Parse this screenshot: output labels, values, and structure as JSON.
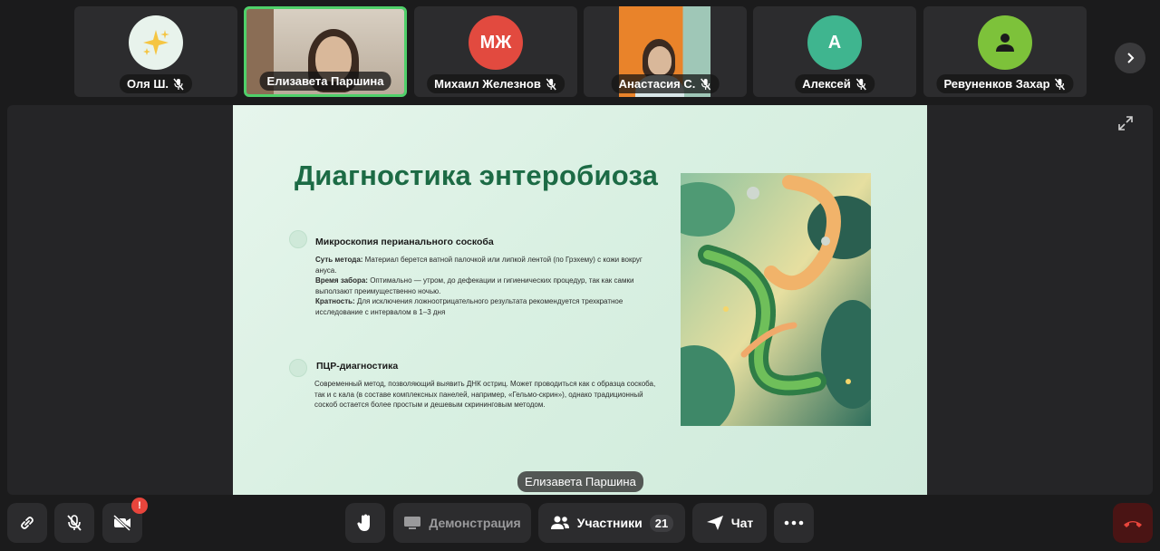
{
  "participants": [
    {
      "name": "Оля Ш.",
      "avatar_icon": "sparkles-icon",
      "avatar_bg": "#e8f3ec",
      "muted": true
    },
    {
      "name": "Елизавета Паршина",
      "video": true,
      "active": true,
      "muted": false
    },
    {
      "name": "Михаил Железнов",
      "initials": "МЖ",
      "avatar_bg": "#e24a3f",
      "muted": true
    },
    {
      "name": "Анастасия С.",
      "video": true,
      "muted": true
    },
    {
      "name": "Алексей",
      "initials": "А",
      "avatar_bg": "#3fb58f",
      "muted": true
    },
    {
      "name": "Ревуненков Захар",
      "avatar_icon": "person-icon",
      "avatar_bg": "#7dc23a",
      "muted": true
    }
  ],
  "slide": {
    "title": "Диагностика энтеробиоза",
    "section1": {
      "title": "Микроскопия перианального соскоба",
      "method_label": "Суть метода:",
      "method_text": " Материал берется ватной палочкой или липкой лентой (по Грэхему) с кожи вокруг ануса.",
      "time_label": "Время забора:",
      "time_text": " Оптимально — утром, до дефекации и гигиенических процедур, так как самки выползают преимущественно ночью.",
      "freq_label": "Кратность:",
      "freq_text": " Для исключения ложноотрицательного результата рекомендуется трехкратное исследование с интервалом в 1–3 дня"
    },
    "section2": {
      "title": "ПЦР-диагностика",
      "text": "Современный метод, позволяющий выявить ДНК остриц. Может проводиться как с образца соскоба, так и с кала (в составе комплексных панелей, например, «Гельмо-скрин»), однако традиционный соскоб остается более простым и дешевым скрининговым методом."
    }
  },
  "speaker_label": "Елизавета Паршина",
  "toolbar": {
    "demo_label": "Демонстрация",
    "participants_label": "Участники",
    "participants_count": "21",
    "chat_label": "Чат",
    "camera_badge": "!"
  },
  "colors": {
    "active_border": "#4fd06a",
    "title_green": "#1c6b45",
    "hangup_red": "#e8453c"
  }
}
